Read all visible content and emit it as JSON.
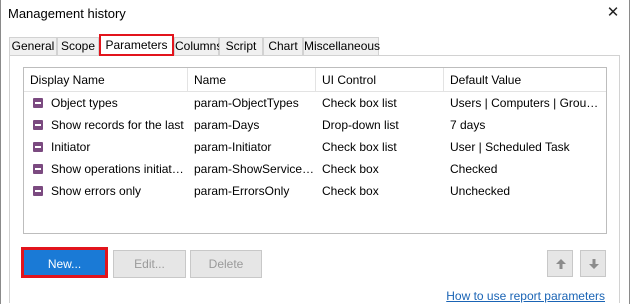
{
  "window": {
    "title": "Management history"
  },
  "tabs": [
    {
      "label": "General"
    },
    {
      "label": "Scope"
    },
    {
      "label": "Parameters",
      "active": true
    },
    {
      "label": "Columns"
    },
    {
      "label": "Script"
    },
    {
      "label": "Chart"
    },
    {
      "label": "Miscellaneous"
    }
  ],
  "grid": {
    "columns": [
      "Display Name",
      "Name",
      "UI Control",
      "Default Value"
    ],
    "rows": [
      [
        "Object types",
        "param-ObjectTypes",
        "Check box list",
        "Users | Computers | Groups ..."
      ],
      [
        "Show records for the last",
        "param-Days",
        "Drop-down list",
        "7 days"
      ],
      [
        "Initiator",
        "param-Initiator",
        "Check box list",
        "User | Scheduled Task"
      ],
      [
        "Show operations initiated...",
        "param-ShowServiceS...",
        "Check box",
        "Checked"
      ],
      [
        "Show errors only",
        "param-ErrorsOnly",
        "Check box",
        "Unchecked"
      ]
    ]
  },
  "buttons": {
    "new": "New...",
    "edit": "Edit...",
    "delete": "Delete"
  },
  "icons": {
    "close": "close-icon",
    "row": "parameter-icon",
    "up": "arrow-up-icon",
    "down": "arrow-down-icon"
  },
  "colors": {
    "accent": "#1a7ad6",
    "highlight": "#e2141c",
    "param_icon": "#7b4a80",
    "link": "#1a64b5"
  },
  "footer": {
    "help_link": "How to use report parameters"
  }
}
